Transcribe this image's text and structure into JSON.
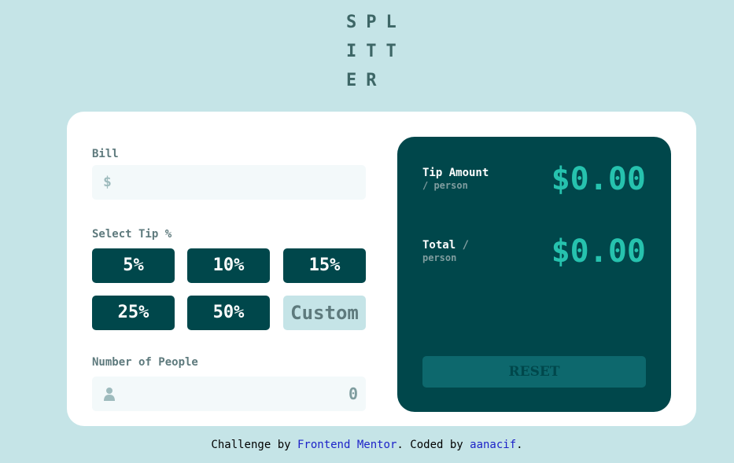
{
  "logo": "SPLITTER",
  "bill": {
    "label": "Bill",
    "currency_symbol": "$",
    "value": ""
  },
  "tip": {
    "label": "Select Tip %",
    "options": [
      "5%",
      "10%",
      "15%",
      "25%",
      "50%"
    ],
    "custom_placeholder": "Custom"
  },
  "people": {
    "label": "Number of People",
    "value": "0",
    "icon": "person-icon"
  },
  "results": {
    "tip_amount": {
      "label": "Tip Amount",
      "sublabel": "/ person",
      "value": "$0.00"
    },
    "total": {
      "label": "Total",
      "slash": "/",
      "sublabel": "person",
      "value": "$0.00"
    },
    "reset_label": "RESET"
  },
  "footer": {
    "prefix": "Challenge by ",
    "link1": "Frontend Mentor",
    "middle": ". Coded by ",
    "link2": "aanacif",
    "suffix": "."
  },
  "colors": {
    "background": "#c5e4e7",
    "dark_cyan": "#00474b",
    "strong_cyan": "#26c2ae",
    "card": "#ffffff"
  }
}
